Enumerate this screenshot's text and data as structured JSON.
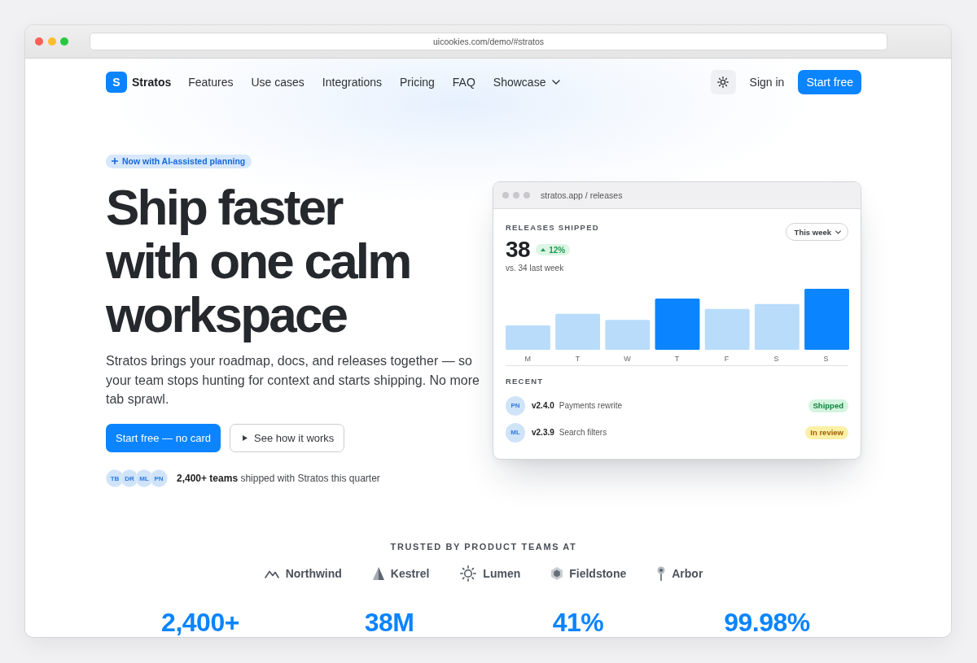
{
  "browser": {
    "url": "uicookies.com/demo/#stratos"
  },
  "nav": {
    "logo": {
      "mark": "S",
      "name": "Stratos"
    },
    "links": [
      {
        "label": "Features",
        "kind": "link"
      },
      {
        "label": "Use cases",
        "kind": "link"
      },
      {
        "label": "Integrations",
        "kind": "link"
      },
      {
        "label": "Pricing",
        "kind": "link"
      },
      {
        "label": "FAQ",
        "kind": "link"
      },
      {
        "label": "Showcase",
        "kind": "dropdown"
      }
    ],
    "sign_in": "Sign in",
    "cta": "Start free"
  },
  "hero": {
    "badge": "Now with AI-assisted planning",
    "headline": [
      "Ship faster",
      "with one calm",
      "workspace"
    ],
    "description": "Stratos brings your roadmap, docs, and releases together — so your team stops hunting for context and starts shipping. No more tab sprawl.",
    "buttons": [
      {
        "label": "Start free — no card",
        "kind": "primary"
      },
      {
        "label": "See how it works",
        "kind": "secondary"
      }
    ],
    "social_proof": {
      "avatars": [
        "TB",
        "DR",
        "ML",
        "PN"
      ],
      "text": "**2,400+ teams** shipped with Stratos this quarter"
    }
  },
  "dashboard": {
    "title": "stratos.app / releases",
    "metric": {
      "label": "RELEASES SHIPPED",
      "value": "38",
      "change": "12%",
      "comparison": "vs. 34 last week"
    },
    "period": "This week",
    "days": [
      {
        "label": "M",
        "highlighted": false
      },
      {
        "label": "T",
        "highlighted": false
      },
      {
        "label": "W",
        "highlighted": false
      },
      {
        "label": "T",
        "highlighted": true
      },
      {
        "label": "F",
        "highlighted": false
      },
      {
        "label": "S",
        "highlighted": false
      },
      {
        "label": "S",
        "highlighted": true
      }
    ],
    "recent": {
      "heading": "RECENT",
      "items": [
        {
          "avatar": "PN",
          "version": "v2.4.0",
          "title": "Payments rewrite",
          "status": {
            "label": "Shipped",
            "kind": "success"
          }
        },
        {
          "avatar": "ML",
          "version": "v2.3.9",
          "title": "Search filters",
          "status": {
            "label": "In review",
            "kind": "pending"
          }
        }
      ]
    }
  },
  "trusted": {
    "heading": "TRUSTED BY PRODUCT TEAMS AT",
    "logos": [
      {
        "name": "Northwind",
        "kind": "peaks"
      },
      {
        "name": "Kestrel",
        "kind": "spire"
      },
      {
        "name": "Lumen",
        "kind": "sun"
      },
      {
        "name": "Fieldstone",
        "kind": "hexagon"
      },
      {
        "name": "Arbor",
        "kind": "pin"
      }
    ]
  },
  "stats": [
    "2,400+",
    "38M",
    "41%",
    "99.98%"
  ]
}
